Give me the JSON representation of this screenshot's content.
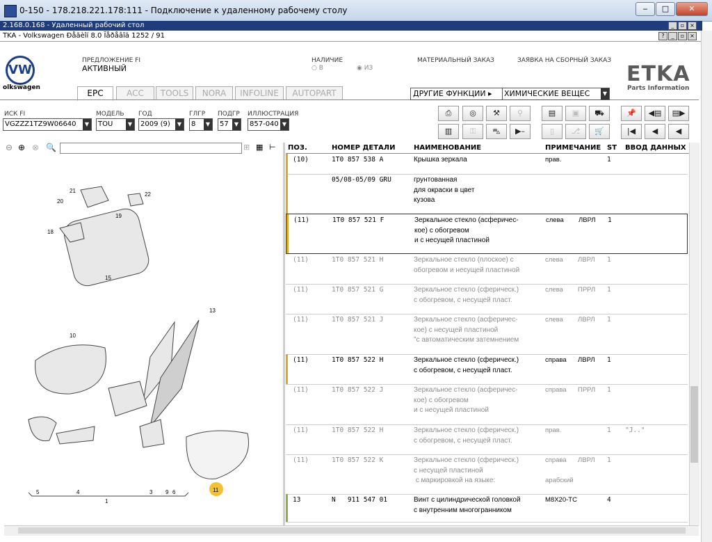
{
  "window": {
    "title": "0-150 - 178.218.221.178:111 - Подключение к удаленному рабочему столу"
  },
  "rdp": {
    "title": "2.168.0.168 - Удаленный рабочий стол"
  },
  "etka_window": {
    "title": "TKA - Volkswagen Ðåãèîí 8.0 Ïåðåâîä 1252 / 91"
  },
  "brand": {
    "vw_text": "olkswagen",
    "etka_logo": "ETKA",
    "etka_sub": "Parts Information"
  },
  "header": {
    "offer_label": "ПРЕДЛОЖЕНИЕ FI",
    "offer_value": "АКТИВНЫЙ",
    "avail_label": "НАЛИЧИЕ",
    "avail_opt1": "В",
    "avail_opt2": "ИЗ",
    "material_order": "МАТЕРИАЛЬНЫЙ ЗАКАЗ",
    "assembly_order": "ЗАЯВКА НА СБОРНЫЙ ЗАКАЗ"
  },
  "tabs": [
    "EPC",
    "ACC",
    "TOOLS",
    "NORA",
    "INFOLINE",
    "AUTOPART"
  ],
  "other_functions": "ДРУГИЕ ФУНКЦИИ ▸",
  "chem_select": "ХИМИЧЕСКИЕ ВЕЩЕС",
  "filters": {
    "vin_label": "ИСК FI",
    "vin_value": "VGZZZ1TZ9W06640",
    "model_label": "МОДЕЛЬ",
    "model_value": "TOU",
    "year_label": "ГОД",
    "year_value": "2009 (9)",
    "hg_label": "ГЛГР",
    "hg_value": "8",
    "sg_label": "ПОДГР",
    "sg_value": "57",
    "ill_label": "ИЛЛЮСТРАЦИЯ",
    "ill_value": "857-040"
  },
  "table": {
    "headers": {
      "pos": "ПОЗ.",
      "num": "НОМЕР ДЕТАЛИ",
      "name": "НАИМЕНОВАНИЕ",
      "note": "ПРИМЕЧАНИЕ",
      "st": "ST",
      "input": "ВВОД ДАННЫХ ПО"
    },
    "rows": [
      {
        "pos": "(10)",
        "num": "1T0 857 538 A",
        "name": "Крышка зеркала",
        "note": "прав.",
        "note2": "",
        "st": "1",
        "inp": "",
        "grey": false,
        "bar": "#e0a820"
      },
      {
        "pos": "",
        "num": "05/08-05/09 GRU",
        "name": "грунтованная\nдля окраски в цвет\nкузова",
        "note": "",
        "note2": "",
        "st": "",
        "inp": "",
        "grey": false,
        "bar": "#e0a820"
      },
      {
        "pos": "(11)",
        "num": "1T0 857 521 F",
        "name": "Зеркальное стекло (асферичес-\nкое) с обогревом\nи с несущей пластиной",
        "note": "слева",
        "note2": "ЛВРЛ",
        "st": "1",
        "inp": "",
        "grey": false,
        "bar": "#e0a820"
      },
      {
        "pos": "(11)",
        "num": "1T0 857 521 H",
        "name": "Зеркальное стекло (плоское) с\nобогревом и несущей пластиной",
        "note": "слева",
        "note2": "ЛВРЛ",
        "st": "1",
        "inp": "",
        "grey": true,
        "bar": ""
      },
      {
        "pos": "(11)",
        "num": "1T0 857 521 G",
        "name": "Зеркальное стекло (сферическ.)\nс обогревом, с несущей пласт.",
        "note": "слева",
        "note2": "ПРРЛ",
        "st": "1",
        "inp": "",
        "grey": true,
        "bar": ""
      },
      {
        "pos": "(11)",
        "num": "1T0 857 521 J",
        "name": "Зеркальное стекло (асферичес-\nкое) с несущей пластиной\n\"с автоматическим затемнением",
        "note": "слева",
        "note2": "ЛВРЛ",
        "st": "1",
        "inp": "",
        "grey": true,
        "bar": ""
      },
      {
        "pos": "(11)",
        "num": "1T0 857 522 H",
        "name": "Зеркальное стекло (сферическ.)\nс обогревом, с несущей пласт.",
        "note": "справа",
        "note2": "ЛВРЛ",
        "st": "1",
        "inp": "",
        "grey": false,
        "bar": "#e0a820"
      },
      {
        "pos": "(11)",
        "num": "1T0 857 522 J",
        "name": "Зеркальное стекло (асферичес-\nкое) с обогревом\nи с несущей пластиной",
        "note": "справа",
        "note2": "ПРРЛ",
        "st": "1",
        "inp": "",
        "grey": true,
        "bar": ""
      },
      {
        "pos": "(11)",
        "num": "1T0 857 522 H",
        "name": "Зеркальное стекло (сферическ.)\nс обогревом, с несущей пласт.",
        "note": "прав.",
        "note2": "",
        "st": "1",
        "inp": "\"J..\"",
        "grey": true,
        "bar": ""
      },
      {
        "pos": "(11)",
        "num": "1T0 857 522 K",
        "name": "Зеркальное стекло (сферическ.)\nс несущей пластиной\n с маркировкой на языке:",
        "note": "справа\n\nарабский",
        "note2": "ЛВРЛ",
        "st": "1",
        "inp": "",
        "grey": true,
        "bar": ""
      },
      {
        "pos": "13",
        "num": "N   911 547 01",
        "name": "Винт с цилиндрической головкой\nс внутренним многогранником",
        "note": "M8X20-TC",
        "note2": "",
        "st": "4",
        "inp": "",
        "grey": false,
        "bar": "#8ab04a"
      }
    ]
  },
  "diagram": {
    "labels": [
      "21",
      "22",
      "20",
      "19",
      "18",
      "15",
      "13",
      "10",
      "5",
      "4",
      "3",
      "9",
      "6",
      "11",
      "1"
    ]
  },
  "colors": {
    "accent": "#e0a820",
    "rdp_blue": "#1f3c7c",
    "green_bar": "#8ab04a"
  }
}
